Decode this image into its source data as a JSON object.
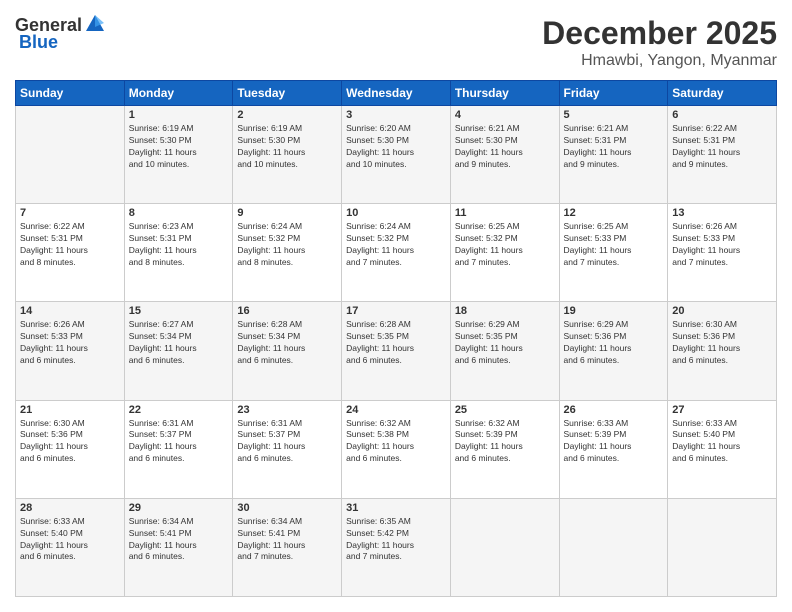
{
  "header": {
    "logo_general": "General",
    "logo_blue": "Blue",
    "month": "December 2025",
    "location": "Hmawbi, Yangon, Myanmar"
  },
  "days_of_week": [
    "Sunday",
    "Monday",
    "Tuesday",
    "Wednesday",
    "Thursday",
    "Friday",
    "Saturday"
  ],
  "weeks": [
    [
      {
        "day": "",
        "info": ""
      },
      {
        "day": "1",
        "info": "Sunrise: 6:19 AM\nSunset: 5:30 PM\nDaylight: 11 hours\nand 10 minutes."
      },
      {
        "day": "2",
        "info": "Sunrise: 6:19 AM\nSunset: 5:30 PM\nDaylight: 11 hours\nand 10 minutes."
      },
      {
        "day": "3",
        "info": "Sunrise: 6:20 AM\nSunset: 5:30 PM\nDaylight: 11 hours\nand 10 minutes."
      },
      {
        "day": "4",
        "info": "Sunrise: 6:21 AM\nSunset: 5:30 PM\nDaylight: 11 hours\nand 9 minutes."
      },
      {
        "day": "5",
        "info": "Sunrise: 6:21 AM\nSunset: 5:31 PM\nDaylight: 11 hours\nand 9 minutes."
      },
      {
        "day": "6",
        "info": "Sunrise: 6:22 AM\nSunset: 5:31 PM\nDaylight: 11 hours\nand 9 minutes."
      }
    ],
    [
      {
        "day": "7",
        "info": "Sunrise: 6:22 AM\nSunset: 5:31 PM\nDaylight: 11 hours\nand 8 minutes."
      },
      {
        "day": "8",
        "info": "Sunrise: 6:23 AM\nSunset: 5:31 PM\nDaylight: 11 hours\nand 8 minutes."
      },
      {
        "day": "9",
        "info": "Sunrise: 6:24 AM\nSunset: 5:32 PM\nDaylight: 11 hours\nand 8 minutes."
      },
      {
        "day": "10",
        "info": "Sunrise: 6:24 AM\nSunset: 5:32 PM\nDaylight: 11 hours\nand 7 minutes."
      },
      {
        "day": "11",
        "info": "Sunrise: 6:25 AM\nSunset: 5:32 PM\nDaylight: 11 hours\nand 7 minutes."
      },
      {
        "day": "12",
        "info": "Sunrise: 6:25 AM\nSunset: 5:33 PM\nDaylight: 11 hours\nand 7 minutes."
      },
      {
        "day": "13",
        "info": "Sunrise: 6:26 AM\nSunset: 5:33 PM\nDaylight: 11 hours\nand 7 minutes."
      }
    ],
    [
      {
        "day": "14",
        "info": "Sunrise: 6:26 AM\nSunset: 5:33 PM\nDaylight: 11 hours\nand 6 minutes."
      },
      {
        "day": "15",
        "info": "Sunrise: 6:27 AM\nSunset: 5:34 PM\nDaylight: 11 hours\nand 6 minutes."
      },
      {
        "day": "16",
        "info": "Sunrise: 6:28 AM\nSunset: 5:34 PM\nDaylight: 11 hours\nand 6 minutes."
      },
      {
        "day": "17",
        "info": "Sunrise: 6:28 AM\nSunset: 5:35 PM\nDaylight: 11 hours\nand 6 minutes."
      },
      {
        "day": "18",
        "info": "Sunrise: 6:29 AM\nSunset: 5:35 PM\nDaylight: 11 hours\nand 6 minutes."
      },
      {
        "day": "19",
        "info": "Sunrise: 6:29 AM\nSunset: 5:36 PM\nDaylight: 11 hours\nand 6 minutes."
      },
      {
        "day": "20",
        "info": "Sunrise: 6:30 AM\nSunset: 5:36 PM\nDaylight: 11 hours\nand 6 minutes."
      }
    ],
    [
      {
        "day": "21",
        "info": "Sunrise: 6:30 AM\nSunset: 5:36 PM\nDaylight: 11 hours\nand 6 minutes."
      },
      {
        "day": "22",
        "info": "Sunrise: 6:31 AM\nSunset: 5:37 PM\nDaylight: 11 hours\nand 6 minutes."
      },
      {
        "day": "23",
        "info": "Sunrise: 6:31 AM\nSunset: 5:37 PM\nDaylight: 11 hours\nand 6 minutes."
      },
      {
        "day": "24",
        "info": "Sunrise: 6:32 AM\nSunset: 5:38 PM\nDaylight: 11 hours\nand 6 minutes."
      },
      {
        "day": "25",
        "info": "Sunrise: 6:32 AM\nSunset: 5:39 PM\nDaylight: 11 hours\nand 6 minutes."
      },
      {
        "day": "26",
        "info": "Sunrise: 6:33 AM\nSunset: 5:39 PM\nDaylight: 11 hours\nand 6 minutes."
      },
      {
        "day": "27",
        "info": "Sunrise: 6:33 AM\nSunset: 5:40 PM\nDaylight: 11 hours\nand 6 minutes."
      }
    ],
    [
      {
        "day": "28",
        "info": "Sunrise: 6:33 AM\nSunset: 5:40 PM\nDaylight: 11 hours\nand 6 minutes."
      },
      {
        "day": "29",
        "info": "Sunrise: 6:34 AM\nSunset: 5:41 PM\nDaylight: 11 hours\nand 6 minutes."
      },
      {
        "day": "30",
        "info": "Sunrise: 6:34 AM\nSunset: 5:41 PM\nDaylight: 11 hours\nand 7 minutes."
      },
      {
        "day": "31",
        "info": "Sunrise: 6:35 AM\nSunset: 5:42 PM\nDaylight: 11 hours\nand 7 minutes."
      },
      {
        "day": "",
        "info": ""
      },
      {
        "day": "",
        "info": ""
      },
      {
        "day": "",
        "info": ""
      }
    ]
  ]
}
